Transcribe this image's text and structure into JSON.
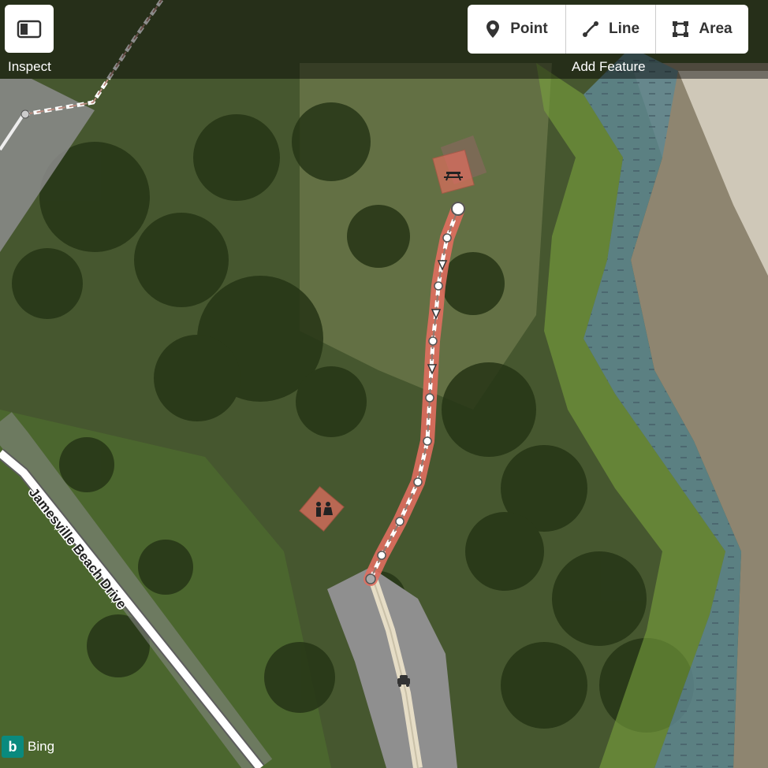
{
  "toolbar": {
    "inspect_label": "Inspect",
    "add_feature_label": "Add Feature",
    "point_label": "Point",
    "line_label": "Line",
    "area_label": "Area"
  },
  "map": {
    "road_label": "Jamesville Beach Drive",
    "attribution": "Bing",
    "selected_color": "#e06e5f",
    "water_color": "#5f8790",
    "grass_color": "#7aa23e"
  }
}
